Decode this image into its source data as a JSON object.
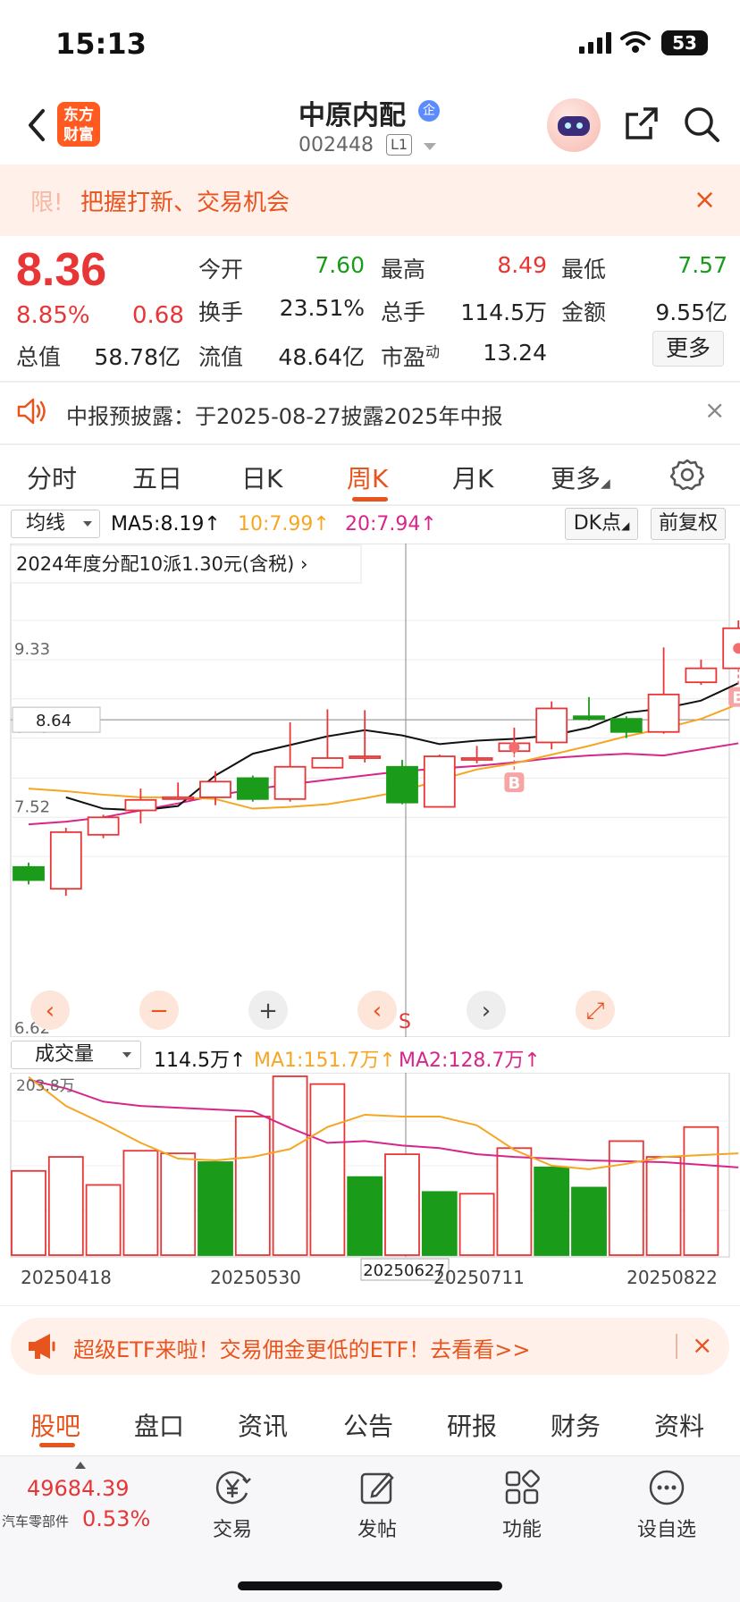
{
  "status": {
    "time": "15:13",
    "battery": "53"
  },
  "header": {
    "logo_line1": "东方",
    "logo_line2": "财富",
    "stock_name": "中原内配",
    "badge": "企",
    "stock_code": "002448",
    "level": "L1"
  },
  "promo": {
    "prefix": "限!",
    "text": "把握打新、交易机会",
    "close": "×"
  },
  "quote": {
    "price": "8.36",
    "pct": "8.85%",
    "change": "0.68",
    "total_value_label": "总值",
    "total_value": "58.78亿",
    "rows": [
      [
        {
          "label": "今开",
          "value": "7.60"
        },
        {
          "label": "最高",
          "value": "8.49"
        },
        {
          "label": "最低",
          "value": "7.57"
        }
      ],
      [
        {
          "label": "换手",
          "value": "23.51%"
        },
        {
          "label": "总手",
          "value": "114.5万"
        },
        {
          "label": "金额",
          "value": "9.55亿"
        }
      ],
      [
        {
          "label": "流值",
          "value": "48.64亿"
        },
        {
          "label": "市盈",
          "sup": "动",
          "value": "13.24"
        }
      ]
    ],
    "more_label": "更多"
  },
  "notice": {
    "text": "中报预披露：于2025-08-27披露2025年中报",
    "close": "×"
  },
  "tabs": {
    "items": [
      "分时",
      "五日",
      "日K",
      "周K",
      "月K",
      "更多"
    ],
    "active": "周K"
  },
  "chart_toolbar": {
    "selector": "均线",
    "ma5": "MA5:8.19↑",
    "ma10": "10:7.99↑",
    "ma20": "20:7.94↑",
    "dk": "DK点",
    "adjust": "前复权"
  },
  "chart_data": {
    "type": "candlestick",
    "annotation": "2024年度分配10派1.30元(含税)",
    "y_tick_labels": [
      "9.33",
      "8.43",
      "7.52",
      "6.62"
    ],
    "crosshair_label": "8.64",
    "ylim": [
      6.62,
      9.78
    ],
    "candles": [
      {
        "o": 6.95,
        "c": 6.8,
        "h": 7.0,
        "l": 6.75
      },
      {
        "o": 6.7,
        "c": 7.35,
        "h": 7.4,
        "l": 6.62
      },
      {
        "o": 7.32,
        "c": 7.52,
        "h": 7.55,
        "l": 7.28
      },
      {
        "o": 7.6,
        "c": 7.72,
        "h": 7.85,
        "l": 7.45
      },
      {
        "o": 7.73,
        "c": 7.75,
        "h": 7.92,
        "l": 7.72
      },
      {
        "o": 7.75,
        "c": 7.93,
        "h": 8.05,
        "l": 7.66
      },
      {
        "o": 7.97,
        "c": 7.73,
        "h": 8.0,
        "l": 7.7
      },
      {
        "o": 7.73,
        "c": 8.1,
        "h": 8.61,
        "l": 7.7
      },
      {
        "o": 8.09,
        "c": 8.2,
        "h": 8.76,
        "l": 8.08
      },
      {
        "o": 8.2,
        "c": 8.22,
        "h": 8.75,
        "l": 8.15
      },
      {
        "o": 8.1,
        "c": 7.69,
        "h": 8.18,
        "l": 7.67
      },
      {
        "o": 7.64,
        "c": 8.22,
        "h": 8.24,
        "l": 7.64
      },
      {
        "o": 8.2,
        "c": 8.2,
        "h": 8.34,
        "l": 8.14
      },
      {
        "o": 8.28,
        "c": 8.37,
        "h": 8.55,
        "l": 8.25
      },
      {
        "o": 8.38,
        "c": 8.77,
        "h": 8.85,
        "l": 8.3
      },
      {
        "o": 8.68,
        "c": 8.65,
        "h": 8.9,
        "l": 8.63
      },
      {
        "o": 8.65,
        "c": 8.5,
        "h": 8.68,
        "l": 8.43
      },
      {
        "o": 8.5,
        "c": 8.93,
        "h": 9.47,
        "l": 8.48
      },
      {
        "o": 9.07,
        "c": 9.23,
        "h": 9.33,
        "l": 9.04
      },
      {
        "o": 9.23,
        "c": 9.69,
        "h": 9.78,
        "l": 9.23
      }
    ],
    "ma5": [
      null,
      7.75,
      7.62,
      7.6,
      7.65,
      8.0,
      8.25,
      8.35,
      8.45,
      8.52,
      8.46,
      8.36,
      8.4,
      8.42,
      8.46,
      8.55,
      8.72,
      8.77,
      8.86,
      9.06
    ],
    "ma10": [
      7.85,
      7.82,
      7.78,
      7.75,
      7.75,
      7.73,
      7.62,
      7.64,
      7.67,
      7.74,
      7.82,
      7.95,
      8.07,
      8.14,
      8.24,
      8.34,
      8.45,
      8.54,
      8.65,
      8.82
    ],
    "ma20": [
      7.44,
      7.47,
      7.52,
      7.6,
      7.68,
      7.77,
      7.84,
      7.9,
      7.95,
      8.0,
      8.05,
      8.08,
      8.11,
      8.15,
      8.2,
      8.23,
      8.25,
      8.23,
      8.3,
      8.37
    ],
    "markers": [
      {
        "index": 13,
        "label": "B",
        "position": "below"
      },
      {
        "index": 19,
        "label": "B",
        "position": "below"
      },
      {
        "index": 10,
        "label": "S",
        "position": "below"
      }
    ],
    "controls": [
      "‹",
      "−",
      "+",
      "‹",
      "›",
      "⤢"
    ]
  },
  "volume": {
    "selector": "成交量",
    "value": "114.5万↑",
    "ma1": "MA1:151.7万↑",
    "ma2": "MA2:128.7万↑",
    "max_label": "203.8万",
    "values": [
      96,
      112,
      80,
      119,
      116,
      106,
      158,
      203.8,
      195,
      89,
      115,
      72,
      70,
      122,
      100,
      77,
      130,
      112,
      146
    ],
    "up": [
      true,
      true,
      true,
      true,
      true,
      false,
      true,
      true,
      true,
      false,
      true,
      false,
      true,
      true,
      false,
      false,
      true,
      true,
      true
    ],
    "ma1_line": [
      203,
      170,
      150,
      128,
      110,
      108,
      112,
      121,
      146,
      160,
      158,
      158,
      148,
      120,
      102,
      98,
      104,
      112,
      114,
      116
    ],
    "ma2_line": [
      200,
      190,
      175,
      170,
      168,
      166,
      164,
      145,
      128,
      130,
      125,
      122,
      115,
      112,
      110,
      108,
      107,
      106,
      103,
      100
    ],
    "date_labels": [
      "20250418",
      "20250530",
      "20250627",
      "20250711",
      "20250822"
    ]
  },
  "etf": {
    "text": "超级ETF来啦！交易佣金更低的ETF！去看看>>",
    "close": "×"
  },
  "bottom_tabs": {
    "items": [
      "股吧",
      "盘口",
      "资讯",
      "公告",
      "研报",
      "财务",
      "资料"
    ],
    "active": "股吧"
  },
  "footer": {
    "index_value": "49684.39",
    "index_name": "汽车零部件",
    "index_pct": "0.53%",
    "nav": [
      "交易",
      "发帖",
      "功能",
      "设自选"
    ]
  },
  "colors": {
    "up": "#e83535",
    "down": "#1a9c1a",
    "accent": "#e8541e",
    "ma5": "#111111",
    "ma10": "#f5a623",
    "ma20": "#d6268c"
  }
}
